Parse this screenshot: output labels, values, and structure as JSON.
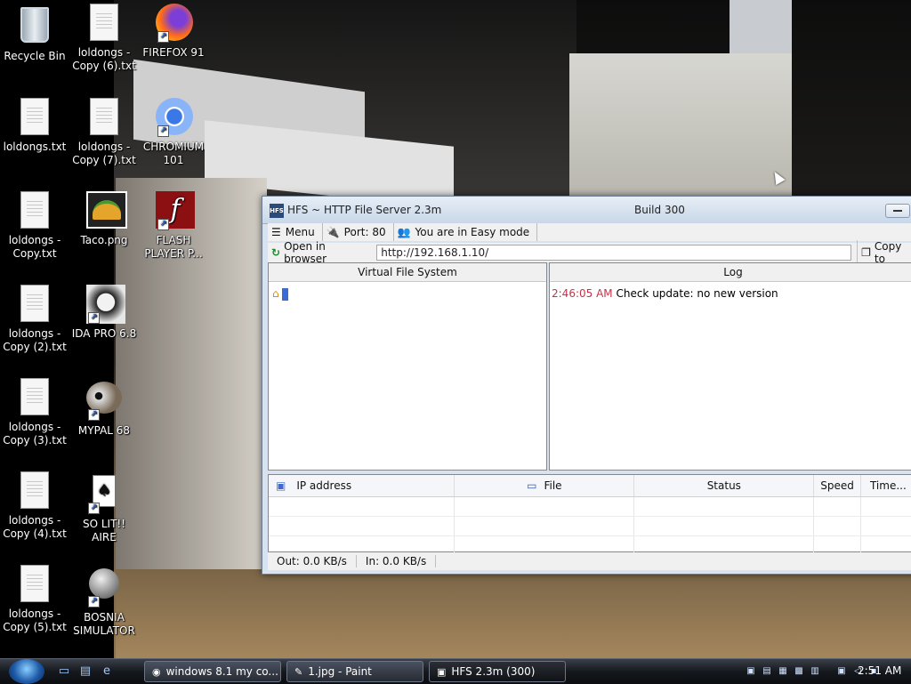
{
  "desktop": {
    "icons": [
      {
        "label": "Recycle Bin"
      },
      {
        "label": "loldongs - Copy (6).txt"
      },
      {
        "label": "FIREFOX 91"
      },
      {
        "label": "loldongs.txt"
      },
      {
        "label": "loldongs - Copy (7).txt"
      },
      {
        "label": "CHROMIUM 101"
      },
      {
        "label": "loldongs - Copy.txt"
      },
      {
        "label": "Taco.png"
      },
      {
        "label": "FLASH PLAYER P..."
      },
      {
        "label": "loldongs - Copy (2).txt"
      },
      {
        "label": "IDA PRO 6.8"
      },
      {
        "label": "loldongs - Copy (3).txt"
      },
      {
        "label": "MYPAL 68"
      },
      {
        "label": "loldongs - Copy (4).txt"
      },
      {
        "label": "SO LIT!! AIRE"
      },
      {
        "label": "loldongs - Copy (5).txt"
      },
      {
        "label": "BOSNIA SIMULATOR"
      }
    ]
  },
  "hfs": {
    "title": "HFS ~ HTTP File Server 2.3m",
    "build": "Build 300",
    "toolbar": {
      "menu": "Menu",
      "port": "Port: 80",
      "mode": "You are in Easy mode"
    },
    "url": {
      "open_label": "Open in browser",
      "value": "http://192.168.1.10/",
      "copy_label": "Copy to"
    },
    "vfs_header": "Virtual File System",
    "log_header": "Log",
    "log": [
      {
        "time": "2:46:05 AM",
        "message": "Check update: no new version"
      }
    ],
    "connections": {
      "columns": [
        "IP address",
        "File",
        "Status",
        "Speed",
        "Time..."
      ]
    },
    "status": {
      "out": "Out: 0.0 KB/s",
      "in": "In: 0.0 KB/s"
    }
  },
  "taskbar": {
    "tasks": [
      {
        "label": "windows 8.1 my co..."
      },
      {
        "label": "1.jpg - Paint"
      },
      {
        "label": "HFS 2.3m (300)"
      }
    ],
    "clock": "2:51 AM"
  },
  "colors": {
    "log_time": "#c8304a",
    "title_bg": "#dbe6f2"
  }
}
